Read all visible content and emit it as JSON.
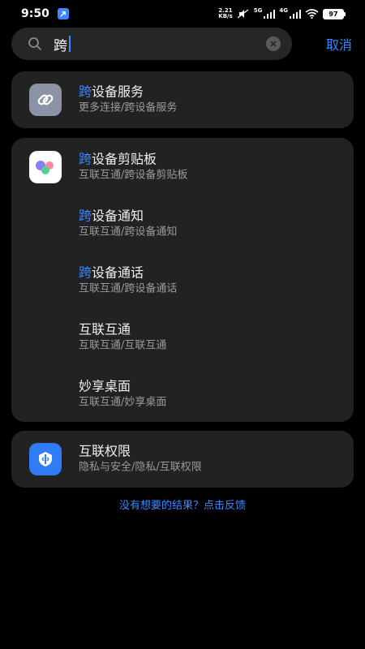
{
  "status_bar": {
    "time": "9:50",
    "net_speed_value": "2.21",
    "net_speed_unit": "KB/s",
    "signal1_label": "5G",
    "signal2_label": "4G",
    "battery": "97"
  },
  "search": {
    "query": "跨",
    "cancel_label": "取消"
  },
  "results": {
    "card1": [
      {
        "highlight": "跨",
        "title_rest": "设备服务",
        "subtitle": "更多连接/跨设备服务",
        "icon": "link-icon"
      }
    ],
    "card2": [
      {
        "highlight": "跨",
        "title_rest": "设备剪贴板",
        "subtitle": "互联互通/跨设备剪贴板",
        "icon": "clipboard-app-icon"
      },
      {
        "highlight": "跨",
        "title_rest": "设备通知",
        "subtitle": "互联互通/跨设备通知"
      },
      {
        "highlight": "跨",
        "title_rest": "设备通话",
        "subtitle": "互联互通/跨设备通话"
      },
      {
        "highlight": "",
        "title_rest": "互联互通",
        "subtitle": "互联互通/互联互通"
      },
      {
        "highlight": "",
        "title_rest": "妙享桌面",
        "subtitle": "互联互通/妙享桌面"
      }
    ],
    "card3": [
      {
        "highlight": "",
        "title_rest": "互联权限",
        "subtitle": "隐私与安全/隐私/互联权限",
        "icon": "permission-shield-icon"
      }
    ]
  },
  "feedback_link": "没有想要的结果？点击反馈",
  "colors": {
    "accent": "#3c87ff",
    "card_bg": "#222222",
    "background": "#000000"
  }
}
